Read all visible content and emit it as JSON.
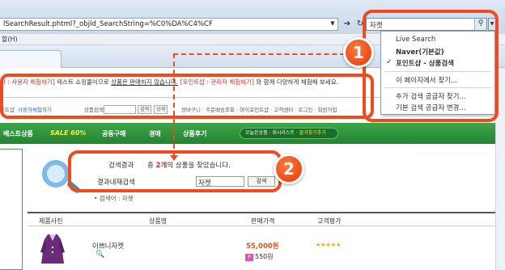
{
  "browser": {
    "address": "lSearchResult.phtml?_objId_SearchString=%C0%DA%C4%CF",
    "refresh_icon": "refresh-icon",
    "menu_label": "할(H)",
    "search_value": "자켓"
  },
  "search_dropdown": {
    "items": [
      {
        "label": "Live Search"
      },
      {
        "label": "Naver(기본값)"
      },
      {
        "label": "포인트샵 - 상품검색",
        "checked": true
      },
      {
        "label": "이 페이지에서 찾기..."
      },
      {
        "label": "추가 검색 공급자 찾기..."
      },
      {
        "label": "기본 검색 공급자 변경..."
      }
    ],
    "check_mark": "✓"
  },
  "page": {
    "notice": {
      "part1": "다 : 사용자 체험하기]",
      "part2": " 테스트 쇼핑몰이므로 ",
      "part3": "상품은 판매하지 않습니다.",
      "part4": " [포인트샵 : 관리자 체험하기]",
      "part5": " 와 함께 다양하게 체험해 보세요."
    },
    "util": {
      "left": "인트샵",
      "user_link": "사용자체험",
      "suffix": "하기",
      "search_label": "상품검색",
      "btn_search": "검색",
      "btn_detail": "상세",
      "links": "장바구니  ·  주문배송조회  ·  마이포인트샵  ·  고객센터  ·  로그인  ·  회원가입"
    },
    "nav": {
      "items": [
        "베스트상품",
        "SALE 60%",
        "공동구매",
        "경매",
        "상품후기"
      ],
      "pill": {
        "a": "오늘본상품",
        "b": "위시리스트",
        "c": "즐겨찾기추가"
      }
    },
    "result": {
      "label_result": "검색결과",
      "sentence_prefix": "총 ",
      "count": "2개",
      "sentence_suffix": "의 상품을 찾았습니다.",
      "label_within": "결과내재검색",
      "within_value": "자켓",
      "btn_search": "검색",
      "hint": "• 검색어 : 자켓"
    },
    "table": {
      "headers": [
        "제품사진",
        "상품명",
        "판매가격",
        "고객평가"
      ]
    },
    "product": {
      "name": "이쁘니자켓",
      "price": "55,000원",
      "point": "550원",
      "point_badge": "P",
      "stars": "★★★★★",
      "rating_fraction": 1.0
    }
  },
  "annotations": {
    "badge1": "1",
    "badge2": "2"
  },
  "colors": {
    "accent": "#f04a1e",
    "nav_green": "#238331",
    "price": "#e8531f",
    "highlight_red": "#d0302a"
  }
}
